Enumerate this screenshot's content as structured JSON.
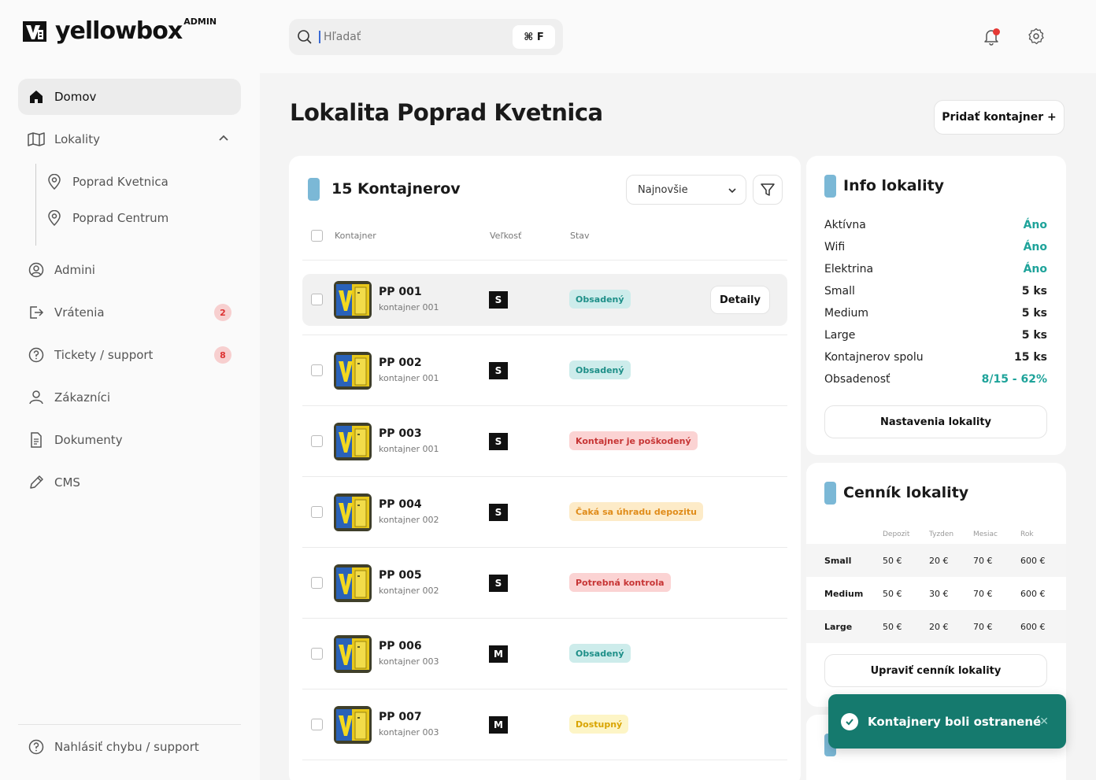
{
  "brand": {
    "name": "yellowbox",
    "tag": "ADMIN"
  },
  "search": {
    "placeholder": "Hľadať",
    "shortcut": "⌘ F"
  },
  "sidebar": {
    "items": [
      {
        "label": "Domov"
      },
      {
        "label": "Lokality"
      },
      {
        "label": "Admini"
      },
      {
        "label": "Vrátenia",
        "badge": "2"
      },
      {
        "label": "Tickety / support",
        "badge": "8"
      },
      {
        "label": "Zákazníci"
      },
      {
        "label": "Dokumenty"
      },
      {
        "label": "CMS"
      }
    ],
    "locations": [
      {
        "label": "Poprad Kvetnica"
      },
      {
        "label": "Poprad Centrum"
      }
    ],
    "report": "Nahlásiť chybu / support"
  },
  "page": {
    "title": "Lokalita Poprad Kvetnica",
    "add_button": "Pridať kontajner +"
  },
  "containers": {
    "title": "15 Kontajnerov",
    "sort": "Najnovšie",
    "columns": {
      "container": "Kontajner",
      "size": "Veľkosť",
      "status": "Stav"
    },
    "detail_label": "Detaily",
    "rows": [
      {
        "name": "PP 001",
        "sub": "kontajner 001",
        "size": "S",
        "status": "Obsadený",
        "kind": "occupied"
      },
      {
        "name": "PP 002",
        "sub": "kontajner 001",
        "size": "S",
        "status": "Obsadený",
        "kind": "occupied"
      },
      {
        "name": "PP 003",
        "sub": "kontajner 001",
        "size": "S",
        "status": "Kontajner je poškodený",
        "kind": "damaged"
      },
      {
        "name": "PP 004",
        "sub": "kontajner 002",
        "size": "S",
        "status": "Čaká sa úhradu depozitu",
        "kind": "deposit"
      },
      {
        "name": "PP 005",
        "sub": "kontajner 002",
        "size": "S",
        "status": "Potrebná kontrola",
        "kind": "check"
      },
      {
        "name": "PP 006",
        "sub": "kontajner 003",
        "size": "M",
        "status": "Obsadený",
        "kind": "occupied"
      },
      {
        "name": "PP 007",
        "sub": "kontajner 003",
        "size": "M",
        "status": "Dostupný",
        "kind": "available"
      }
    ]
  },
  "info": {
    "title": "Info lokality",
    "rows": [
      {
        "label": "Aktívna",
        "value": "Áno",
        "teal": true
      },
      {
        "label": "Wifi",
        "value": "Áno",
        "teal": true
      },
      {
        "label": "Elektrina",
        "value": "Áno",
        "teal": true
      },
      {
        "label": "Small",
        "value": "5 ks"
      },
      {
        "label": "Medium",
        "value": "5 ks"
      },
      {
        "label": "Large",
        "value": "5 ks"
      },
      {
        "label": "Kontajnerov spolu",
        "value": "15 ks"
      },
      {
        "label": "Obsadenosť",
        "value": "8/15 - 62%",
        "teal": true
      }
    ],
    "button": "Nastavenia lokality"
  },
  "pricing": {
    "title": "Cenník lokality",
    "columns": [
      "Depozit",
      "Tyzden",
      "Mesiac",
      "Rok"
    ],
    "rows": [
      {
        "label": "Small",
        "values": [
          "50 €",
          "20 €",
          "70 €",
          "600 €"
        ]
      },
      {
        "label": "Medium",
        "values": [
          "50 €",
          "30 €",
          "70 €",
          "600 €"
        ]
      },
      {
        "label": "Large",
        "values": [
          "50 €",
          "20 €",
          "70 €",
          "600 €"
        ]
      }
    ],
    "button": "Upraviť cenník lokality"
  },
  "toast": {
    "message": "Kontajnery boli ostranené"
  },
  "colors": {
    "accent": "#7bb8d6",
    "teal": "#1ea39a",
    "toast": "#157a6e",
    "badge_bg": "#f7cfcf"
  }
}
